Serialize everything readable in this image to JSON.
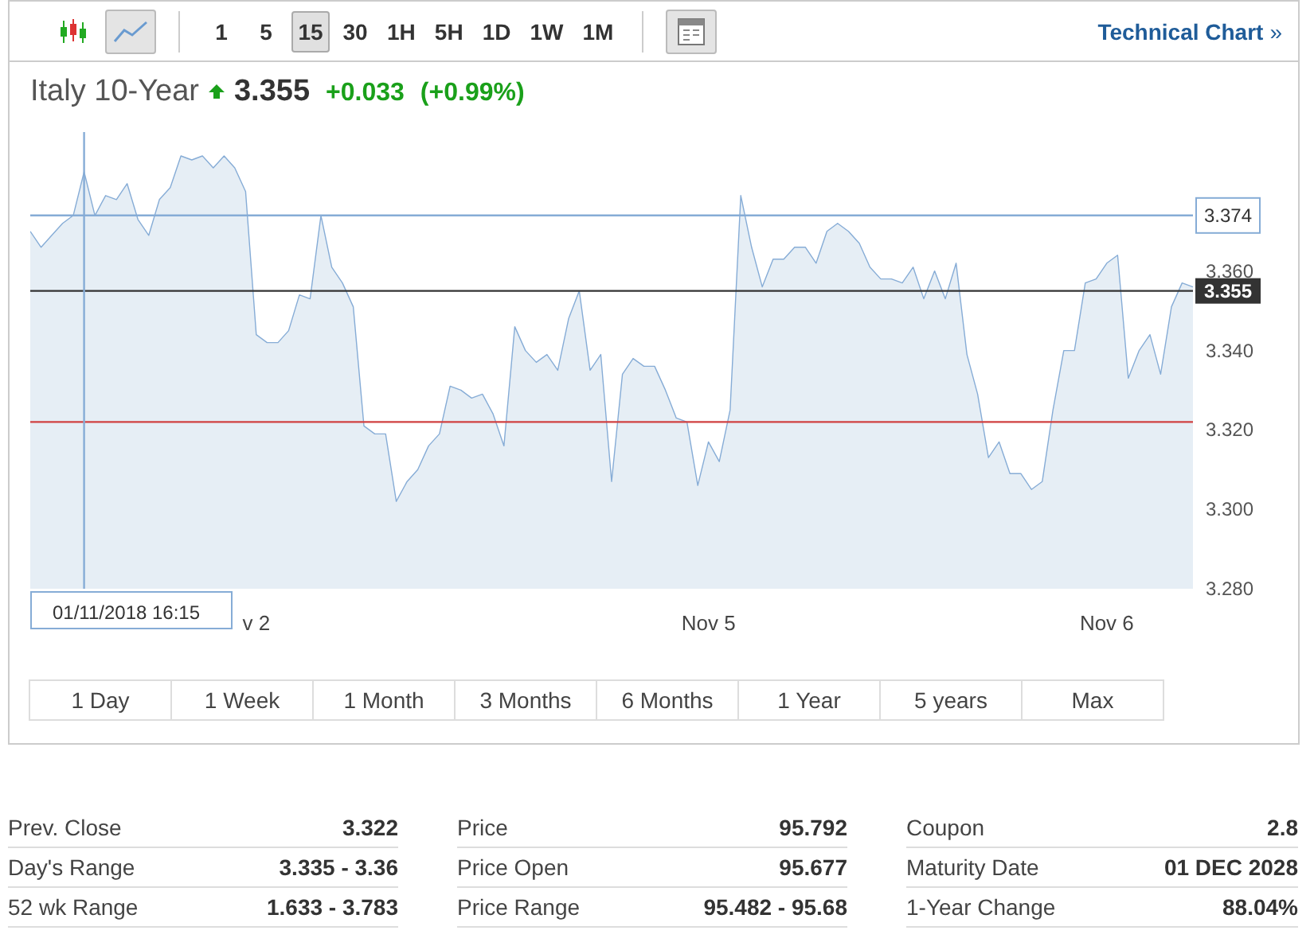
{
  "toolbar": {
    "chart_types": [
      {
        "kind": "candles",
        "selected": false
      },
      {
        "kind": "line",
        "selected": true
      }
    ],
    "intervals": [
      {
        "label": "1",
        "selected": false
      },
      {
        "label": "5",
        "selected": false
      },
      {
        "label": "15",
        "selected": true
      },
      {
        "label": "30",
        "selected": false
      },
      {
        "label": "1H",
        "selected": false
      },
      {
        "label": "5H",
        "selected": false
      },
      {
        "label": "1D",
        "selected": false
      },
      {
        "label": "1W",
        "selected": false
      },
      {
        "label": "1M",
        "selected": false
      }
    ],
    "link": "Technical Chart",
    "link_arrow": "»"
  },
  "header": {
    "name": "Italy 10-Year",
    "trend_up": true,
    "price": "3.355",
    "change": "+0.033",
    "change_pct": "(+0.99%)"
  },
  "chart": {
    "tooltip": "01/11/2018 16:15",
    "chart_data": {
      "type": "area",
      "ylim": [
        3.28,
        3.395
      ],
      "categories": [
        null,
        null,
        null,
        null,
        null,
        null,
        null,
        null,
        null,
        null,
        null,
        null,
        null,
        null,
        null,
        null,
        null,
        null,
        null,
        null,
        null,
        "v 2",
        null,
        null,
        null,
        null,
        null,
        null,
        null,
        null,
        null,
        null,
        null,
        null,
        null,
        null,
        null,
        null,
        null,
        null,
        null,
        null,
        null,
        null,
        null,
        null,
        null,
        null,
        null,
        null,
        null,
        null,
        null,
        null,
        null,
        null,
        null,
        null,
        null,
        null,
        null,
        null,
        null,
        "Nov 5",
        null,
        null,
        null,
        null,
        null,
        null,
        null,
        null,
        null,
        null,
        null,
        null,
        null,
        null,
        null,
        null,
        null,
        null,
        null,
        null,
        null,
        null,
        null,
        null,
        null,
        null,
        null,
        null,
        null,
        null,
        null,
        null,
        null,
        null,
        null,
        null,
        "Nov 6",
        null,
        null,
        null,
        null,
        null,
        null,
        null,
        null
      ],
      "yticks": [
        {
          "value": 3.28,
          "label": "3.280"
        },
        {
          "value": 3.3,
          "label": "3.300"
        },
        {
          "value": 3.32,
          "label": "3.320"
        },
        {
          "value": 3.34,
          "label": "3.340"
        },
        {
          "value": 3.36,
          "label": "3.360"
        }
      ],
      "series": [
        {
          "color": "#86acd6",
          "values": [
            3.37,
            3.366,
            3.369,
            3.372,
            3.374,
            3.385,
            3.374,
            3.379,
            3.378,
            3.382,
            3.373,
            3.369,
            3.378,
            3.381,
            3.389,
            3.388,
            3.389,
            3.386,
            3.389,
            3.386,
            3.38,
            3.344,
            3.342,
            3.342,
            3.345,
            3.354,
            3.353,
            3.374,
            3.361,
            3.357,
            3.351,
            3.321,
            3.319,
            3.319,
            3.302,
            3.307,
            3.31,
            3.316,
            3.319,
            3.331,
            3.33,
            3.328,
            3.329,
            3.324,
            3.316,
            3.346,
            3.34,
            3.337,
            3.339,
            3.335,
            3.348,
            3.355,
            3.335,
            3.339,
            3.307,
            3.334,
            3.338,
            3.336,
            3.336,
            3.33,
            3.323,
            3.322,
            3.306,
            3.317,
            3.312,
            3.325,
            3.379,
            3.366,
            3.356,
            3.363,
            3.363,
            3.366,
            3.366,
            3.362,
            3.37,
            3.372,
            3.37,
            3.367,
            3.361,
            3.358,
            3.358,
            3.357,
            3.361,
            3.353,
            3.36,
            3.353,
            3.362,
            3.339,
            3.329,
            3.313,
            3.317,
            3.309,
            3.309,
            3.305,
            3.307,
            3.325,
            3.34,
            3.34,
            3.357,
            3.358,
            3.362,
            3.364,
            3.333,
            3.34,
            3.344,
            3.334,
            3.351,
            3.357,
            3.356
          ]
        }
      ],
      "ref_lines": [
        {
          "axis": "y",
          "value": 3.374,
          "label": "3.374",
          "color": "#86acd6"
        },
        {
          "axis": "y",
          "value": 3.355,
          "label": "3.355",
          "color": "#333333"
        },
        {
          "axis": "y",
          "value": 3.322,
          "color": "#d04040"
        }
      ]
    }
  },
  "ranges": [
    {
      "label": "1 Day",
      "selected": false
    },
    {
      "label": "1 Week",
      "selected": false
    },
    {
      "label": "1 Month",
      "selected": false
    },
    {
      "label": "3 Months",
      "selected": false
    },
    {
      "label": "6 Months",
      "selected": false
    },
    {
      "label": "1 Year",
      "selected": false
    },
    {
      "label": "5 years",
      "selected": false
    },
    {
      "label": "Max",
      "selected": false
    }
  ],
  "stats": [
    [
      {
        "label": "Prev. Close",
        "value": "3.322"
      },
      {
        "label": "Day's Range",
        "value": "3.335 - 3.36"
      },
      {
        "label": "52 wk Range",
        "value": "1.633 - 3.783"
      }
    ],
    [
      {
        "label": "Price",
        "value": "95.792"
      },
      {
        "label": "Price Open",
        "value": "95.677"
      },
      {
        "label": "Price Range",
        "value": "95.482 - 95.68"
      }
    ],
    [
      {
        "label": "Coupon",
        "value": "2.8"
      },
      {
        "label": "Maturity Date",
        "value": "01 DEC 2028"
      },
      {
        "label": "1-Year Change",
        "value": "88.04%"
      }
    ]
  ]
}
